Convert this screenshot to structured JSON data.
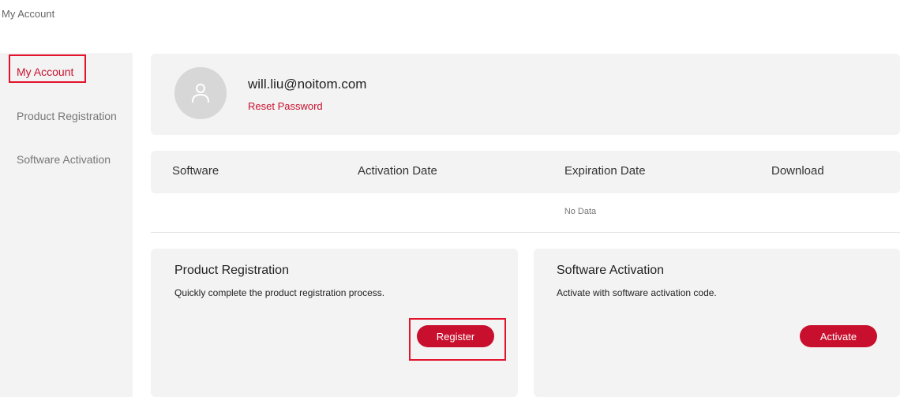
{
  "breadcrumb": "My Account",
  "sidebar": {
    "items": [
      {
        "label": "My Account",
        "active": true
      },
      {
        "label": "Product Registration",
        "active": false
      },
      {
        "label": "Software Activation",
        "active": false
      }
    ]
  },
  "account": {
    "email": "will.liu@noitom.com",
    "reset_password": "Reset Password"
  },
  "software_table": {
    "columns": [
      "Software",
      "Activation Date",
      "Expiration Date",
      "Download"
    ],
    "empty_text": "No Data"
  },
  "product_registration": {
    "title": "Product Registration",
    "description": "Quickly complete the product registration process.",
    "button": "Register"
  },
  "software_activation": {
    "title": "Software Activation",
    "description": "Activate with software activation code.",
    "button": "Activate"
  },
  "colors": {
    "accent": "#c8102e",
    "panel": "#f3f3f3",
    "highlight": "#e3132c"
  },
  "icons": {
    "avatar": "user-icon"
  }
}
